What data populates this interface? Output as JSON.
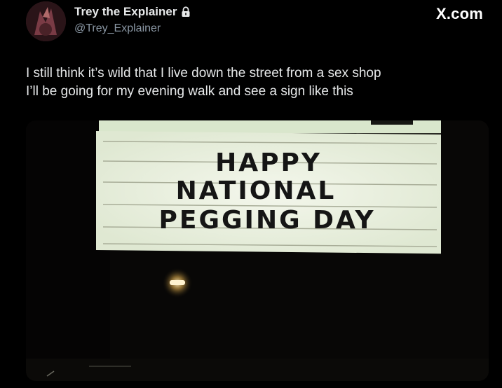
{
  "author": {
    "name": "Trey the Explainer",
    "handle": "@Trey_Explainer",
    "badge_icon": "lock-icon"
  },
  "brand": {
    "label": "X.com"
  },
  "tweet": {
    "lines": [
      "I still think it’s wild that I live down the street from a sex shop",
      "I’ll be going for my evening walk and see a sign like this"
    ]
  },
  "media": {
    "sign_lines": [
      "HAPPY",
      "NATIONAL",
      "PEGGING DAY"
    ]
  },
  "colors": {
    "background": "#000000",
    "text": "#e7e9ea",
    "muted": "#8b98a5",
    "sign_panel": "#eef2e4"
  }
}
